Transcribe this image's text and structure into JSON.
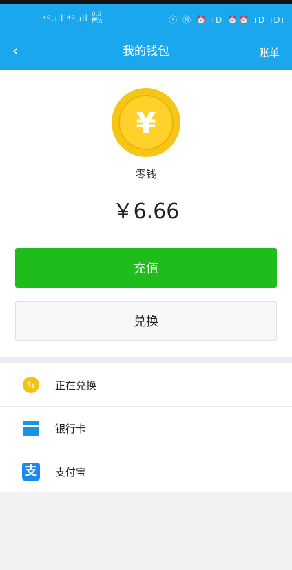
{
  "status_bar": {
    "signal_text": "⁴ᴳ.ıll ⁴ᴳ.ıll ≈",
    "speed_value": "0.9",
    "speed_unit": "M/s",
    "right_icons": "ⓢ Ⓝ ⏰ ıD ⏰⏰ ıD ıDı"
  },
  "header": {
    "back_icon": "‹",
    "title": "我的钱包",
    "bill_label": "账单",
    "bg_color": "#1aa7ee"
  },
  "wallet": {
    "coin_symbol": "¥",
    "label": "零钱",
    "balance": "￥6.66"
  },
  "actions": {
    "recharge_label": "充值",
    "exchange_label": "兑换",
    "recharge_color": "#1ebd1c"
  },
  "list": {
    "items": [
      {
        "label": "正在兑换",
        "icon": "exchange-icon",
        "glyph": "⇆"
      },
      {
        "label": "银行卡",
        "icon": "bank-card-icon"
      },
      {
        "label": "支付宝",
        "icon": "alipay-icon",
        "glyph": "支"
      }
    ]
  }
}
